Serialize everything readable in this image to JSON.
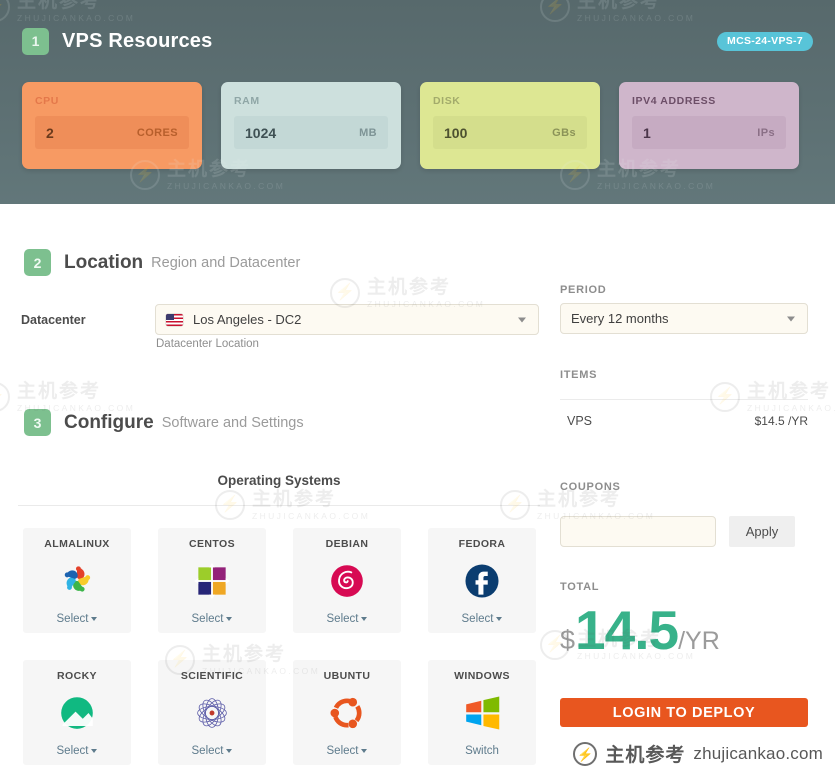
{
  "header": {
    "step": "1",
    "title": "VPS Resources",
    "sku_badge": "MCS-24-VPS-7",
    "resources": [
      {
        "label": "CPU",
        "value": "2",
        "unit": "CORES",
        "theme": "cpu",
        "color": "#f79a63"
      },
      {
        "label": "RAM",
        "value": "1024",
        "unit": "MB",
        "theme": "ram",
        "color": "#cde0dd"
      },
      {
        "label": "DISK",
        "value": "100",
        "unit": "GBs",
        "theme": "disk",
        "color": "#dde793"
      },
      {
        "label": "IPV4 ADDRESS",
        "value": "1",
        "unit": "IPs",
        "theme": "ip",
        "color": "#cfb6cb"
      }
    ]
  },
  "location": {
    "step": "2",
    "title": "Location",
    "subtitle": "Region and Datacenter",
    "datacenter_label": "Datacenter",
    "datacenter_value": "Los Angeles - DC2",
    "datacenter_hint": "Datacenter Location",
    "flag_icon": "us-flag-icon"
  },
  "configure": {
    "step": "3",
    "title": "Configure",
    "subtitle": "Software and Settings",
    "os_section_title": "Operating Systems",
    "operating_systems": [
      {
        "name": "ALMALINUX",
        "action": "Select",
        "has_caret": true,
        "logo": "almalinux-logo"
      },
      {
        "name": "CENTOS",
        "action": "Select",
        "has_caret": true,
        "logo": "centos-logo"
      },
      {
        "name": "DEBIAN",
        "action": "Select",
        "has_caret": true,
        "logo": "debian-logo"
      },
      {
        "name": "FEDORA",
        "action": "Select",
        "has_caret": true,
        "logo": "fedora-logo"
      },
      {
        "name": "ROCKY",
        "action": "Select",
        "has_caret": true,
        "logo": "rocky-logo"
      },
      {
        "name": "SCIENTIFIC",
        "action": "Select",
        "has_caret": true,
        "logo": "scientific-logo"
      },
      {
        "name": "UBUNTU",
        "action": "Select",
        "has_caret": true,
        "logo": "ubuntu-logo"
      },
      {
        "name": "WINDOWS",
        "action": "Switch",
        "has_caret": false,
        "logo": "windows-logo"
      }
    ]
  },
  "order": {
    "period_label": "PERIOD",
    "period_value": "Every 12 months",
    "items_label": "ITEMS",
    "items": [
      {
        "name": "VPS",
        "price": "$14.5 /YR"
      }
    ],
    "coupons_label": "COUPONS",
    "coupon_value": "",
    "coupon_placeholder": "",
    "apply_label": "Apply",
    "total_label": "TOTAL",
    "total_currency": "$",
    "total_amount": "14.5",
    "total_period": "/YR",
    "deploy_label": "LOGIN TO DEPLOY",
    "accent_green": "#38b28a",
    "accent_orange": "#e8561f"
  },
  "watermark": {
    "cn": "主机参考",
    "en": "ZHUJICANKAO.COM",
    "brand_cn": "主机参考",
    "brand_domain": "zhujicankao.com"
  }
}
